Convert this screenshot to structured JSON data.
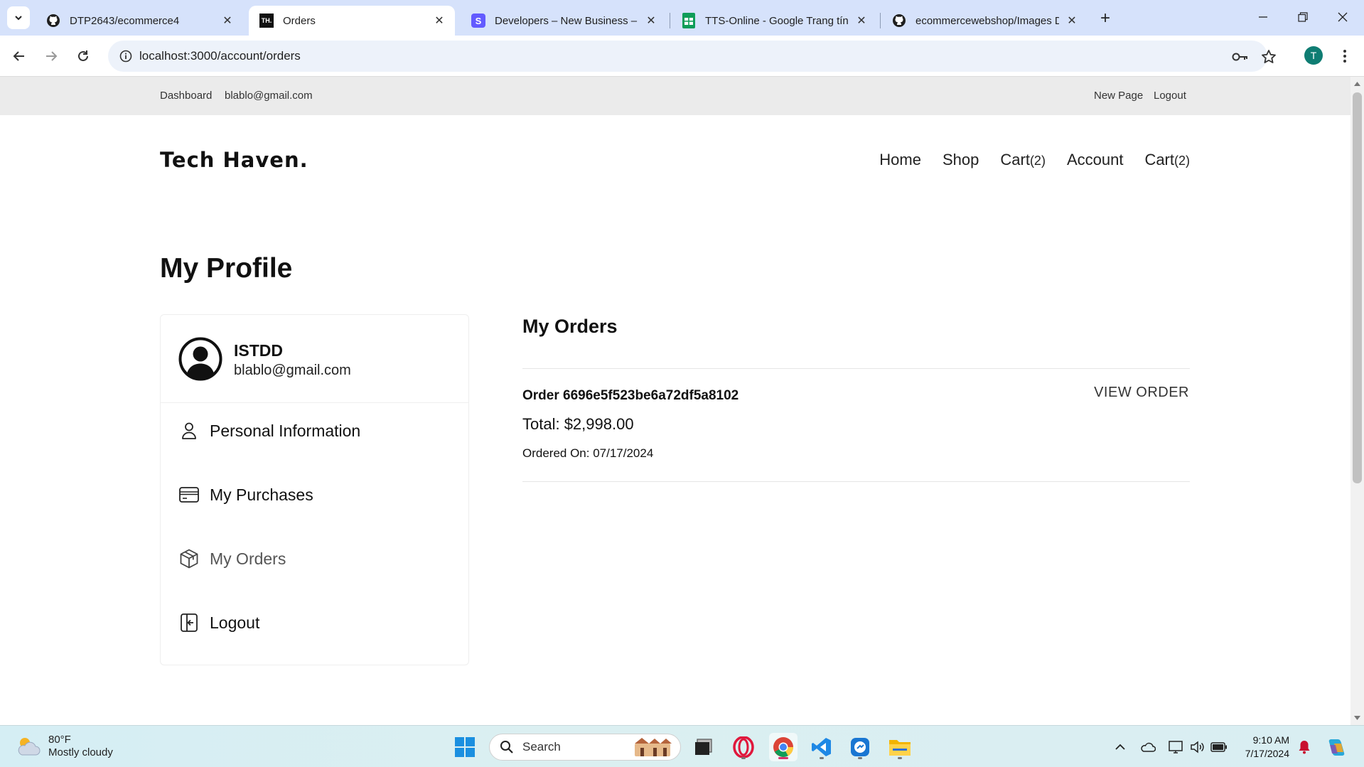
{
  "browser": {
    "tabs": [
      {
        "title": "DTP2643/ecommerce4",
        "icon": "github-icon",
        "active": false
      },
      {
        "title": "Orders",
        "icon": "th-favicon",
        "favicon_text": "TH.",
        "active": true
      },
      {
        "title": "Developers – New Business – St",
        "icon": "stripe-icon",
        "favicon_text": "S",
        "active": false
      },
      {
        "title": "TTS-Online - Google Trang tính",
        "icon": "sheets-icon",
        "active": false
      },
      {
        "title": "ecommercewebshop/Images D",
        "icon": "github-icon",
        "active": false
      }
    ],
    "url": "localhost:3000/account/orders",
    "profile_initial": "T"
  },
  "topbar": {
    "dashboard": "Dashboard",
    "email": "blablo@gmail.com",
    "new_page": "New Page",
    "logout": "Logout"
  },
  "site": {
    "logo": "Tech Haven.",
    "nav": {
      "home": "Home",
      "shop": "Shop",
      "cart1": "Cart",
      "cart1_count": "(2)",
      "account": "Account",
      "cart2": "Cart",
      "cart2_count": "(2)"
    }
  },
  "profile": {
    "title": "My Profile",
    "user_name": "ISTDD",
    "user_email": "blablo@gmail.com",
    "menu": [
      {
        "label": "Personal Information",
        "icon": "user-icon"
      },
      {
        "label": "My Purchases",
        "icon": "credit-card-icon"
      },
      {
        "label": "My Orders",
        "icon": "box-icon",
        "current": true
      },
      {
        "label": "Logout",
        "icon": "logout-icon"
      }
    ]
  },
  "orders": {
    "title": "My Orders",
    "items": [
      {
        "id_label": "Order 6696e5f523be6a72df5a8102",
        "total": "Total: $2,998.00",
        "date": "Ordered On: 07/17/2024",
        "view_label": "VIEW ORDER"
      }
    ]
  },
  "taskbar": {
    "weather_temp": "80°F",
    "weather_desc": "Mostly cloudy",
    "search_placeholder": "Search",
    "time": "9:10 AM",
    "date": "7/17/2024"
  },
  "colors": {
    "tabstrip": "#d6e2fb",
    "topbar": "#ebebeb",
    "profile_avatar": "#0f7d73",
    "sheets_green": "#0f9d58",
    "stripe_purple": "#635bff"
  }
}
